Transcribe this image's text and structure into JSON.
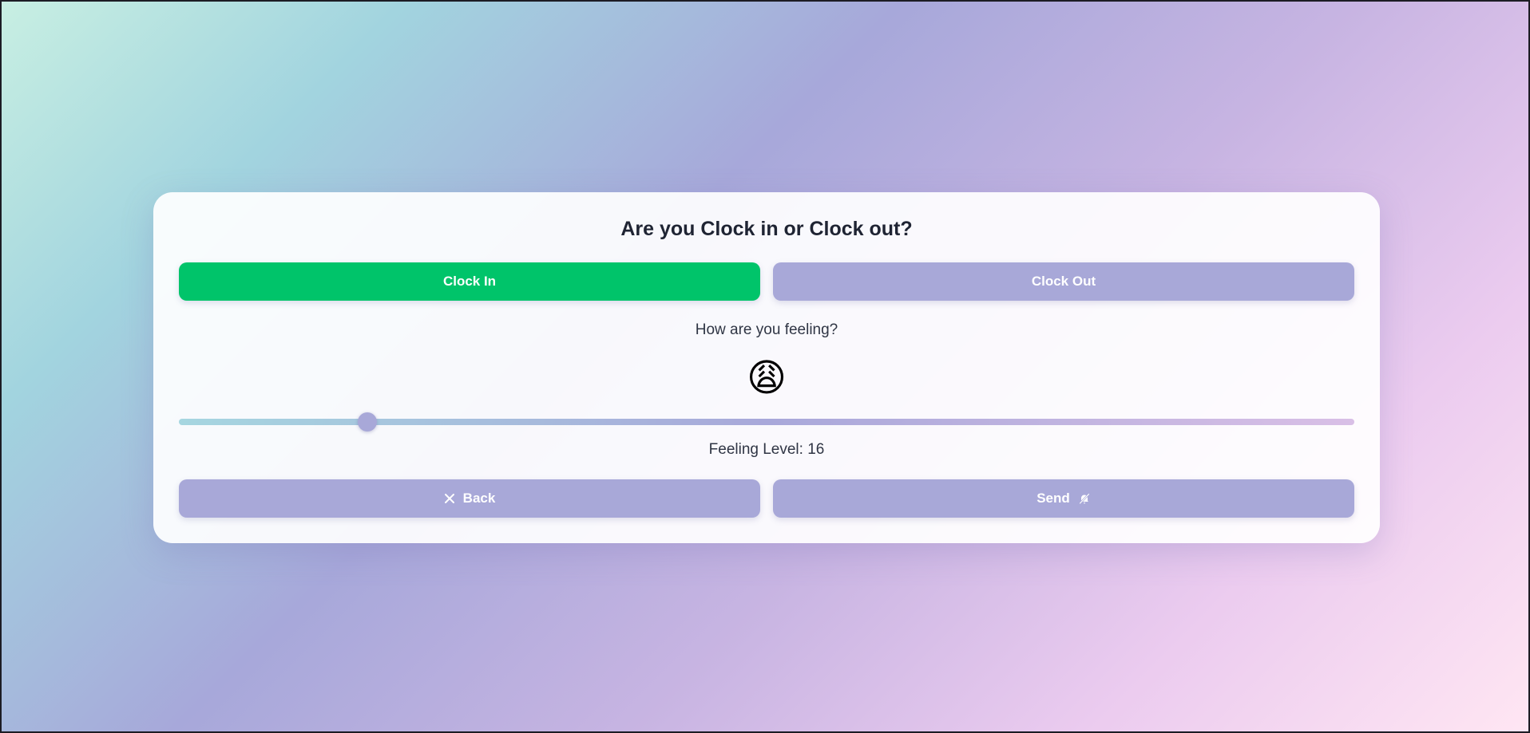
{
  "card": {
    "title": "Are you Clock in or Clock out?",
    "clock_in_label": "Clock In",
    "clock_out_label": "Clock Out",
    "feeling_question": "How are you feeling?",
    "emoji": "😩",
    "emoji_icon": "weary-face-icon",
    "feeling": {
      "level_prefix": "Feeling Level: ",
      "value": 16,
      "min": 0,
      "max": 100,
      "level_text": "Feeling Level: 16"
    },
    "back_label": "Back",
    "back_icon": "close-icon",
    "send_label": "Send",
    "send_icon": "bell-off-icon"
  },
  "colors": {
    "clock_in_active": "#00c46a",
    "button_inactive": "#a8a8d8",
    "title_text": "#1f2433"
  }
}
